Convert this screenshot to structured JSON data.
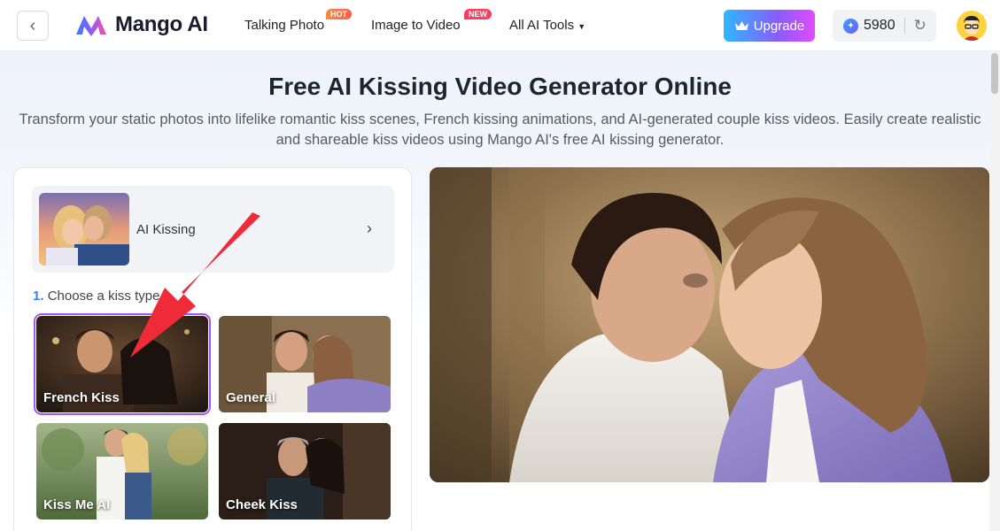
{
  "header": {
    "back_icon": "chevron-left-icon",
    "logo_text": "Mango AI",
    "nav": [
      {
        "label": "Talking Photo",
        "badge": "HOT"
      },
      {
        "label": "Image to Video",
        "badge": "NEW"
      },
      {
        "label": "All AI Tools"
      }
    ],
    "upgrade_label": "Upgrade",
    "credits": "5980"
  },
  "hero": {
    "title": "Free AI Kissing Video Generator Online",
    "description": "Transform your static photos into lifelike romantic kiss scenes, French kissing animations, and AI-generated couple kiss videos. Easily create realistic and shareable kiss videos using Mango AI's free AI kissing generator."
  },
  "panel": {
    "model_label": "AI Kissing",
    "step_number": "1.",
    "step_label": "Choose a kiss type",
    "kiss_types": [
      {
        "label": "French Kiss",
        "selected": true
      },
      {
        "label": "General",
        "selected": false
      },
      {
        "label": "Kiss Me AI",
        "selected": false
      },
      {
        "label": "Cheek Kiss",
        "selected": false
      }
    ]
  },
  "colors": {
    "accent": "#3a7bff",
    "selected_outline": "#a855f7",
    "annotation_arrow": "#ef2b3a"
  }
}
